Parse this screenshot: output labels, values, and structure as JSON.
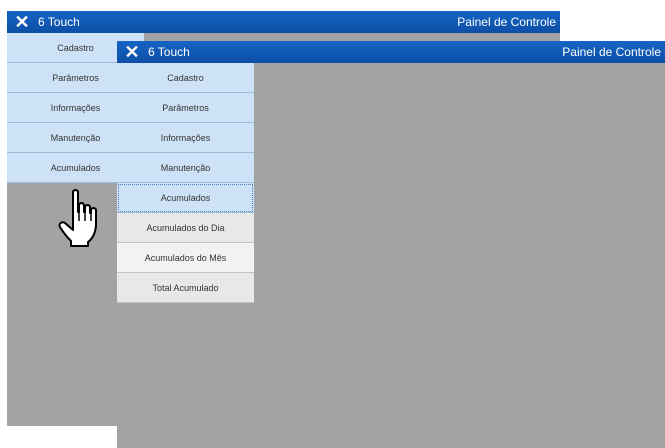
{
  "window_back": {
    "close_glyph": "✕",
    "app_title": "6 Touch",
    "panel_title": "Painel de Controle",
    "menu": [
      "Cadastro",
      "Parâmetros",
      "Informações",
      "Manutenção",
      "Acumulados"
    ]
  },
  "window_front": {
    "close_glyph": "✕",
    "app_title": "6 Touch",
    "panel_title": "Painel de Controle",
    "menu": [
      "Cadastro",
      "Parâmetros",
      "Informações",
      "Manutenção",
      "Acumulados"
    ],
    "submenu": [
      "Acumulados do Dia",
      "Acumulados do Mês",
      "Total Acumulado"
    ],
    "selected_item": "Acumulados"
  },
  "icons": {
    "cursor": "hand-pointer-icon",
    "close": "close-icon"
  },
  "colors": {
    "titlebar": "#1565c4",
    "menu_item": "#cde2f6",
    "workspace": "#a3a3a3"
  }
}
